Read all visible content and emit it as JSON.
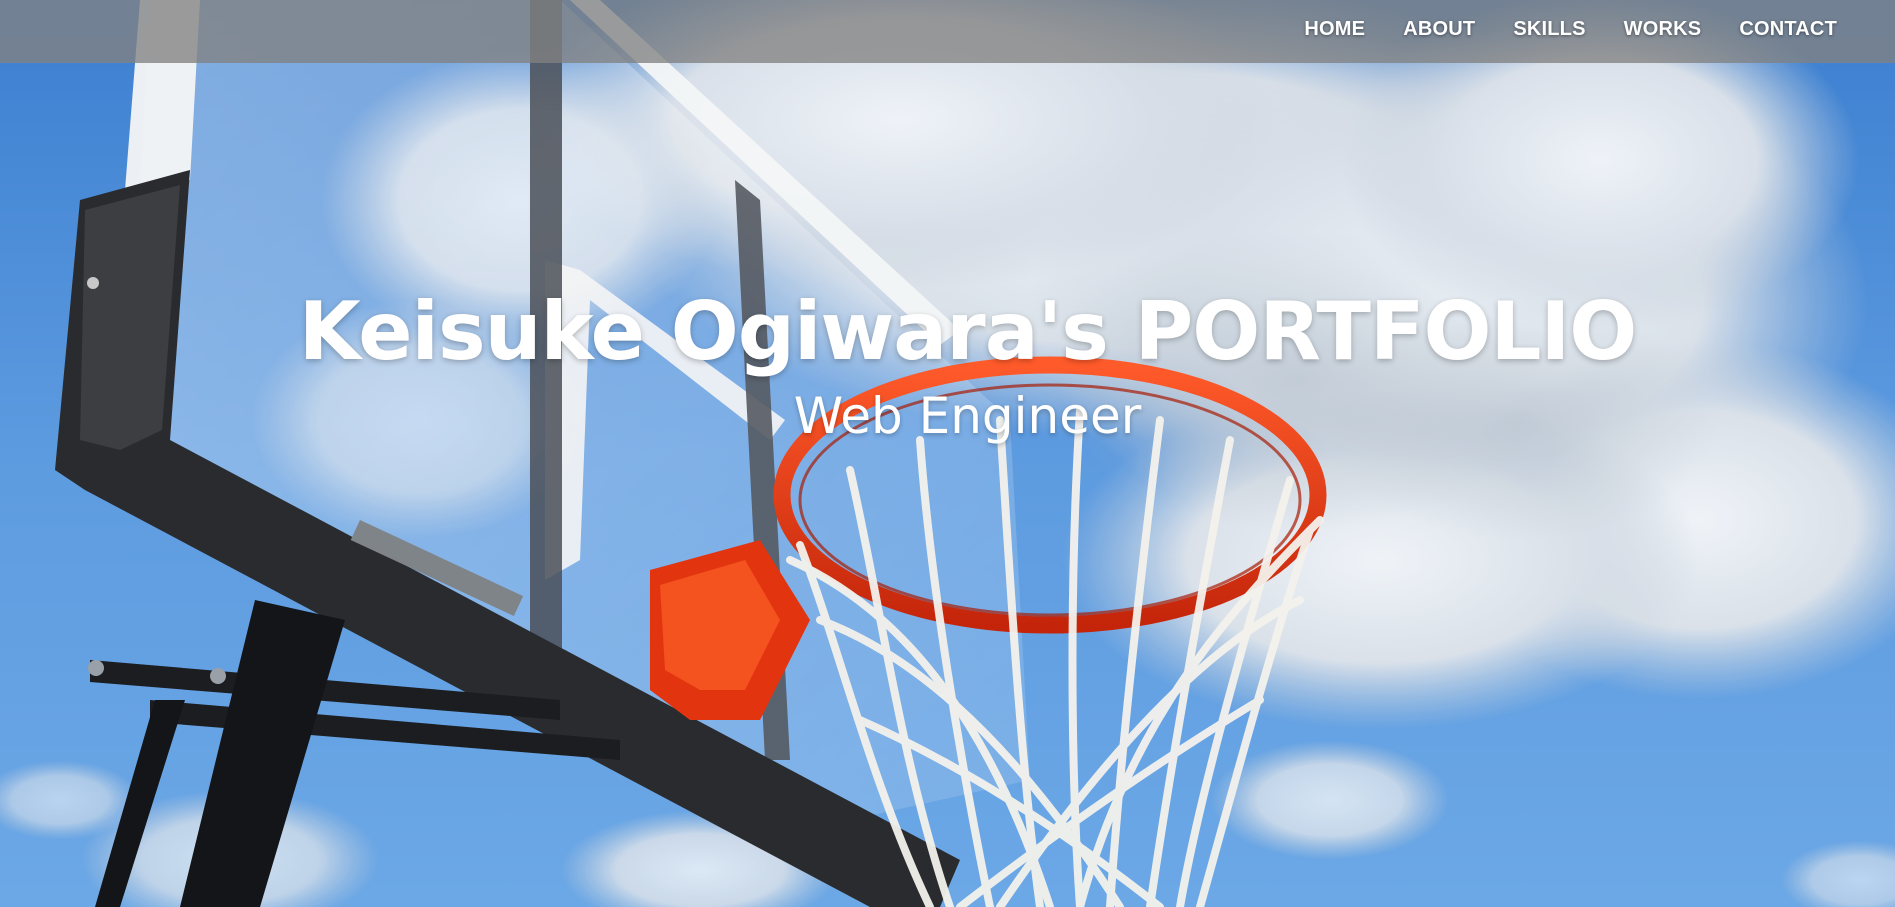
{
  "nav": {
    "items": [
      {
        "label": "HOME"
      },
      {
        "label": "ABOUT"
      },
      {
        "label": "SKILLS"
      },
      {
        "label": "WORKS"
      },
      {
        "label": "CONTACT"
      }
    ]
  },
  "hero": {
    "title": "Keisuke Ogiwara's PORTFOLIO",
    "subtitle": "Web Engineer",
    "background_image": "basketball-hoop-against-cloudy-sky"
  },
  "colors": {
    "sky": "#5a98dc",
    "navbar": "#828282",
    "rim": "#e8320a",
    "text": "#ffffff"
  }
}
